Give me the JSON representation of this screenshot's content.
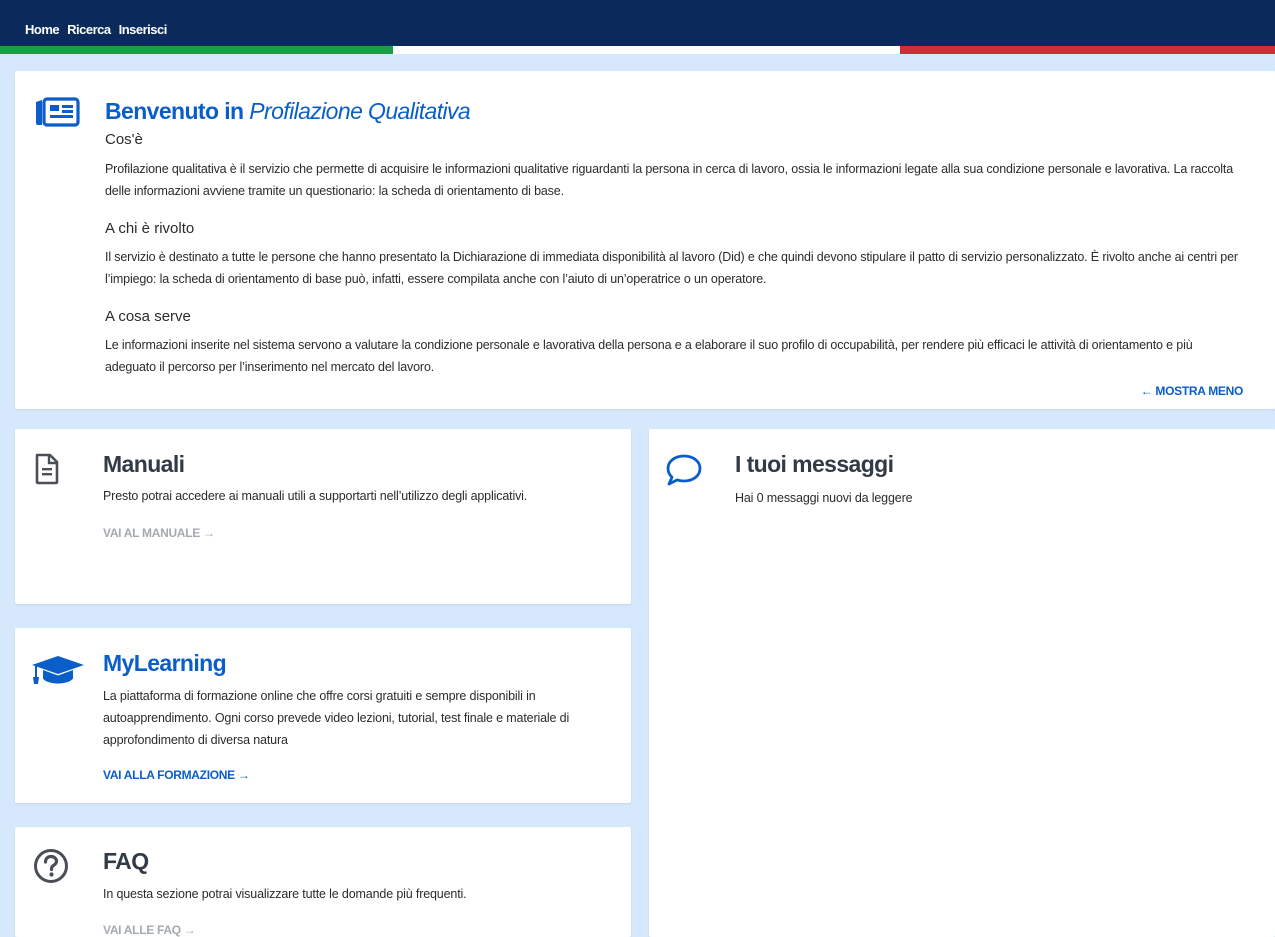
{
  "nav": {
    "home": "Home",
    "ricerca": "Ricerca",
    "inserisci": "Inserisci"
  },
  "colors": {
    "nav_bg": "#0b2a5c",
    "flag_green": "#1a9e45",
    "flag_white": "#ffffff",
    "flag_red": "#d22d36",
    "accent_blue": "#0a5ec9",
    "page_bg": "#d6e8fb"
  },
  "welcome": {
    "title_prefix": "Benvenuto in",
    "title_emph": "Profilazione Qualitativa",
    "icon": "newspaper-icon",
    "sections": [
      {
        "heading": "Cos'è",
        "text": "Profilazione qualitativa è il servizio che permette di acquisire le informazioni qualitative riguardanti la persona in cerca di lavoro, ossia le informazioni legate alla sua condizione personale e lavorativa. La raccolta delle informazioni avviene tramite un questionario: la scheda di orientamento di base."
      },
      {
        "heading": "A chi è rivolto",
        "text": "Il servizio è destinato a tutte le persone che hanno presentato la Dichiarazione di immediata disponibilità al lavoro (Did) e che quindi devono stipulare il patto di servizio personalizzato. È rivolto anche ai centri per l’impiego: la scheda di orientamento di base può, infatti, essere compilata anche con l’aiuto di un’operatrice o un operatore."
      },
      {
        "heading": "A cosa serve",
        "text": "Le informazioni inserite nel sistema servono a valutare la condizione personale e lavorativa della persona e a elaborare il suo profilo di occupabilità, per rendere più efficaci le attività di orientamento e più adeguato il percorso per l’inserimento nel mercato del lavoro."
      }
    ],
    "toggle_link": "← MOSTRA MENO"
  },
  "manuali": {
    "title": "Manuali",
    "icon": "document-icon",
    "text": "Presto potrai accedere ai manuali utili a supportarti nell’utilizzo degli applicativi.",
    "link": "VAI AL MANUALE →"
  },
  "messaggi": {
    "title": "I tuoi messaggi",
    "icon": "chat-bubble-icon",
    "text": "Hai 0 messaggi nuovi da leggere"
  },
  "mylearning": {
    "title": "MyLearning",
    "icon": "graduation-cap-icon",
    "text": "La piattaforma di formazione online che offre corsi gratuiti e sempre disponibili in autoapprendimento. Ogni corso prevede video lezioni, tutorial, test finale e materiale di approfondimento di diversa natura",
    "link": "VAI ALLA FORMAZIONE →"
  },
  "faq": {
    "title": "FAQ",
    "icon": "question-circle-icon",
    "text": "In questa sezione potrai visualizzare tutte le domande più frequenti.",
    "link": "VAI ALLE FAQ →"
  }
}
